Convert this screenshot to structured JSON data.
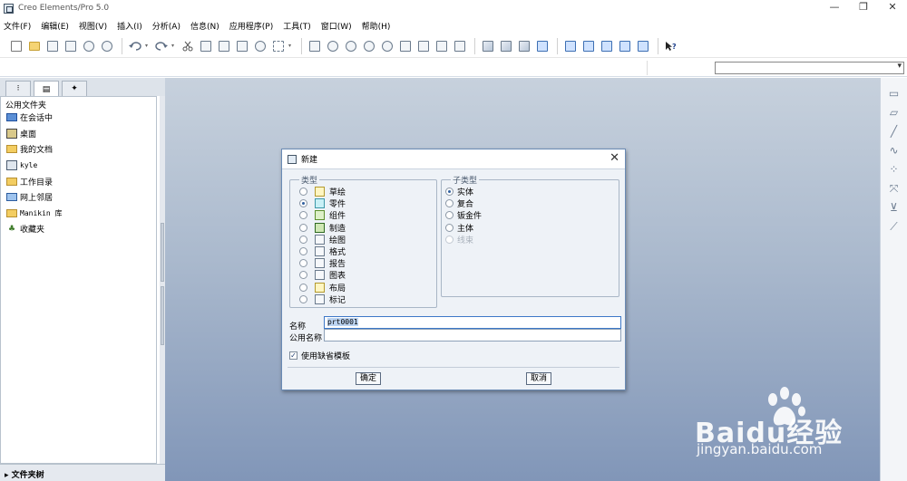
{
  "window": {
    "title": "Creo Elements/Pro 5.0",
    "controls": {
      "minimize": "—",
      "restore": "❐",
      "close": "✕"
    }
  },
  "menubar": {
    "items": [
      "文件(F)",
      "编辑(E)",
      "视图(V)",
      "插入(I)",
      "分析(A)",
      "信息(N)",
      "应用程序(P)",
      "工具(T)",
      "窗口(W)",
      "帮助(H)"
    ]
  },
  "toolbar": {
    "icons": [
      "new-file-icon",
      "open-folder-icon",
      "save-icon",
      "print-icon",
      "send-email-icon",
      "save-copy-icon",
      "undo-icon",
      "redo-icon",
      "cut-icon",
      "copy-icon",
      "paste-icon",
      "paste-special-icon",
      "find-icon",
      "select-box-icon",
      "repaint-icon",
      "spin-center-icon",
      "orient-icon",
      "zoom-in-icon",
      "zoom-out-icon",
      "refit-icon",
      "reorient-icon",
      "saved-views-icon",
      "layers-icon",
      "wireframe-icon",
      "hidden-line-icon",
      "no-hidden-icon",
      "shading-icon",
      "datum-planes-icon",
      "datum-axes-icon",
      "datum-points-icon",
      "coord-sys-icon",
      "annotations-icon",
      "whats-this-icon"
    ]
  },
  "navigator": {
    "tabs": [
      "model-tree-tab-icon",
      "folder-browser-tab-icon",
      "favorites-tab-icon"
    ],
    "header": "公用文件夹",
    "items": [
      {
        "label": "在会话中",
        "icon": "monitor-icon"
      },
      {
        "label": "桌面",
        "icon": "desktop-icon"
      },
      {
        "label": "我的文档",
        "icon": "documents-folder-icon"
      },
      {
        "label": "kyle",
        "icon": "user-folder-icon"
      },
      {
        "label": "工作目录",
        "icon": "working-dir-icon"
      },
      {
        "label": "网上邻居",
        "icon": "network-icon"
      },
      {
        "label": "Manikin 库",
        "icon": "manikin-library-icon"
      },
      {
        "label": "收藏夹",
        "icon": "favorites-icon"
      }
    ],
    "bottom_label": "文件夹树",
    "bottom_arrow": "▸"
  },
  "dialog": {
    "title": "新建",
    "close": "✕",
    "type_group_label": "类型",
    "types": [
      {
        "label": "草绘",
        "selected": false
      },
      {
        "label": "零件",
        "selected": true
      },
      {
        "label": "组件",
        "selected": false
      },
      {
        "label": "制造",
        "selected": false
      },
      {
        "label": "绘图",
        "selected": false
      },
      {
        "label": "格式",
        "selected": false
      },
      {
        "label": "报告",
        "selected": false
      },
      {
        "label": "图表",
        "selected": false
      },
      {
        "label": "布局",
        "selected": false
      },
      {
        "label": "标记",
        "selected": false
      }
    ],
    "subtype_group_label": "子类型",
    "subtypes": [
      {
        "label": "实体",
        "selected": true,
        "disabled": false
      },
      {
        "label": "复合",
        "selected": false,
        "disabled": false
      },
      {
        "label": "钣金件",
        "selected": false,
        "disabled": false
      },
      {
        "label": "主体",
        "selected": false,
        "disabled": false
      },
      {
        "label": "线束",
        "selected": false,
        "disabled": true
      }
    ],
    "name_label": "名称",
    "name_value": "prt0001",
    "common_name_label": "公用名称",
    "common_name_value": "",
    "use_default_template_label": "使用缺省模板",
    "use_default_template_checked": true,
    "ok_label": "确定",
    "cancel_label": "取消"
  },
  "watermark": {
    "brand": "Baidu经验",
    "url": "jingyan.baidu.com"
  }
}
